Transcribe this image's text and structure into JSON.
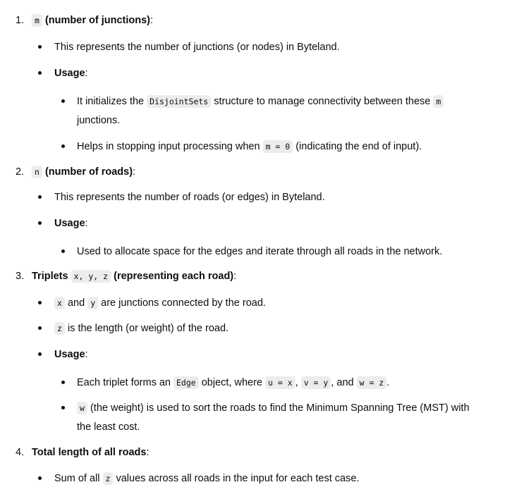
{
  "items": [
    {
      "number": "1.",
      "code": "m",
      "title": "(number of junctions)",
      "colon": ":",
      "desc": "This represents the number of junctions (or nodes) in Byteland.",
      "usage_label": "Usage",
      "usage_colon": ":",
      "usage": [
        {
          "t1": "It initializes the ",
          "c1": "DisjointSets",
          "t2": " structure to manage connectivity between these ",
          "c2": "m",
          "t3": "junctions."
        },
        {
          "t1": "Helps in stopping input processing when ",
          "c1": "m = 0",
          "t2": " (indicating the end of input)."
        }
      ]
    },
    {
      "number": "2.",
      "code": "n",
      "title": "(number of roads)",
      "colon": ":",
      "desc": "This represents the number of roads (or edges) in Byteland.",
      "usage_label": "Usage",
      "usage_colon": ":",
      "usage": [
        {
          "t1": "Used to allocate space for the edges and iterate through all roads in the network."
        }
      ]
    },
    {
      "number": "3.",
      "title_prefix": "Triplets ",
      "code": "x, y, z",
      "title": "(representing each road)",
      "colon": ":",
      "bullets": [
        {
          "c1": "x",
          "t1": " and ",
          "c2": "y",
          "t2": " are junctions connected by the road."
        },
        {
          "c1": "z",
          "t1": " is the length (or weight) of the road."
        }
      ],
      "usage_label": "Usage",
      "usage_colon": ":",
      "usage": [
        {
          "t1": "Each triplet forms an ",
          "c1": "Edge",
          "t2": " object, where ",
          "c2": "u = x",
          "t3": ", ",
          "c3": "v = y",
          "t4": ", and ",
          "c4": "w = z",
          "t5": "."
        },
        {
          "c1": "w",
          "t1": " (the weight) is used to sort the roads to find the Minimum Spanning Tree (MST) with",
          "t2": "the least cost."
        }
      ]
    },
    {
      "number": "4.",
      "title": "Total length of all roads",
      "colon": ":",
      "bullets": [
        {
          "t1": "Sum of all ",
          "c1": "z",
          "t2": " values across all roads in the input for each test case."
        }
      ]
    }
  ]
}
